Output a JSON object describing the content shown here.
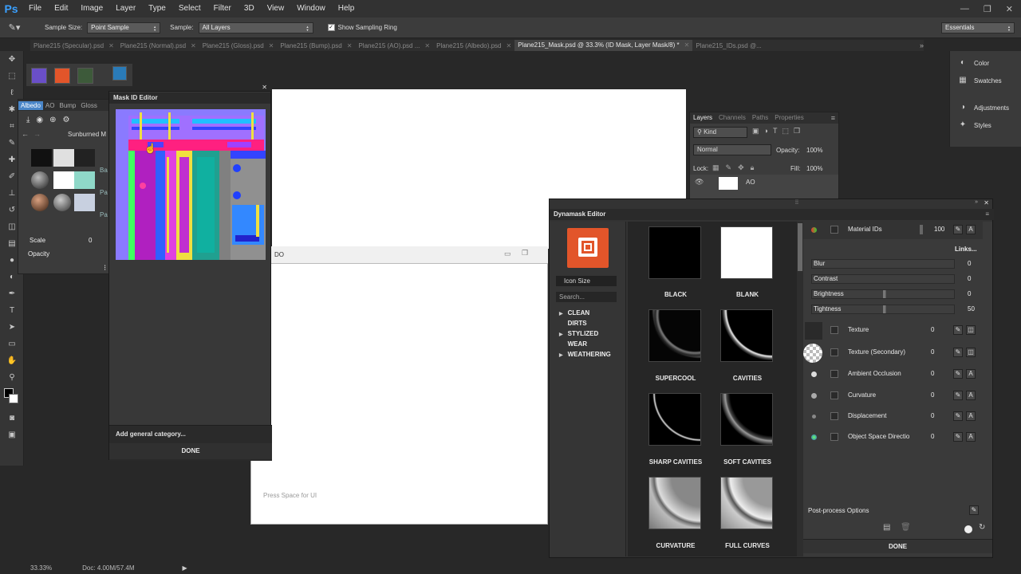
{
  "app": {
    "logo": "Ps"
  },
  "menu": [
    "File",
    "Edit",
    "Image",
    "Layer",
    "Type",
    "Select",
    "Filter",
    "3D",
    "View",
    "Window",
    "Help"
  ],
  "options": {
    "sample_size_label": "Sample Size:",
    "sample_size_value": "Point Sample",
    "sample_label": "Sample:",
    "sample_value": "All Layers",
    "show_ring": "Show Sampling Ring",
    "workspace": "Essentials"
  },
  "doc_tabs": [
    "Plane215 (Specular).psd",
    "Plane215 (Normal).psd",
    "Plane215 (Gloss).psd",
    "Plane215 (Bump).psd",
    "Plane215 (AO).psd ...",
    "Plane215 (Albedo).psd",
    "Plane215_Mask.psd @ 33.3% (ID Mask, Layer Mask/8) *",
    "Plane215_IDs.psd @..."
  ],
  "status": {
    "zoom": "33.33%",
    "doc": "Doc: 4.00M/57.4M"
  },
  "albedo_panel": {
    "tabs": [
      "Albedo",
      "AO",
      "Bump",
      "Gloss"
    ],
    "material": "Sunburned M",
    "scale_label": "Scale",
    "scale_value": "0",
    "opacity_label": "Opacity",
    "row_labels": [
      "Ba",
      "Pa",
      "Pa"
    ]
  },
  "mask_editor": {
    "title": "Mask ID Editor",
    "add_category": "Add general category...",
    "done": "DONE"
  },
  "canvas": {
    "hint": "Press Space for UI",
    "partial_label": "DO"
  },
  "layers_panel": {
    "tabs": [
      "Layers",
      "Channels",
      "Paths",
      "Properties"
    ],
    "kind": "Kind",
    "blend": "Normal",
    "opacity_label": "Opacity:",
    "opacity_value": "100%",
    "lock_label": "Lock:",
    "fill_label": "Fill:",
    "fill_value": "100%",
    "layer_name": "AO"
  },
  "right_dock": [
    "Color",
    "Swatches",
    "Adjustments",
    "Styles"
  ],
  "dynamask": {
    "title": "Dynamask Editor",
    "icon_size": "Icon Size",
    "search": "Search...",
    "categories": [
      "CLEAN",
      "DIRTS",
      "STYLIZED",
      "WEAR",
      "WEATHERING"
    ],
    "masks": [
      "BLACK",
      "BLANK",
      "SUPERCOOL",
      "CAVITIES",
      "SHARP CAVITIES",
      "SOFT CAVITIES",
      "CURVATURE",
      "FULL CURVES"
    ],
    "top_layer": {
      "name": "Material IDs",
      "value": "100",
      "links": "Links..."
    },
    "adjustments": [
      {
        "label": "Blur",
        "value": "0"
      },
      {
        "label": "Contrast",
        "value": "0"
      },
      {
        "label": "Brightness",
        "value": "0"
      },
      {
        "label": "Tightness",
        "value": "50"
      }
    ],
    "layers": [
      {
        "name": "Texture",
        "value": "0"
      },
      {
        "name": "Texture (Secondary)",
        "value": "0"
      },
      {
        "name": "Ambient Occlusion",
        "value": "0"
      },
      {
        "name": "Curvature",
        "value": "0"
      },
      {
        "name": "Displacement",
        "value": "0"
      },
      {
        "name": "Object Space Directio",
        "value": "0"
      }
    ],
    "post_process": "Post-process Options",
    "done": "DONE"
  }
}
